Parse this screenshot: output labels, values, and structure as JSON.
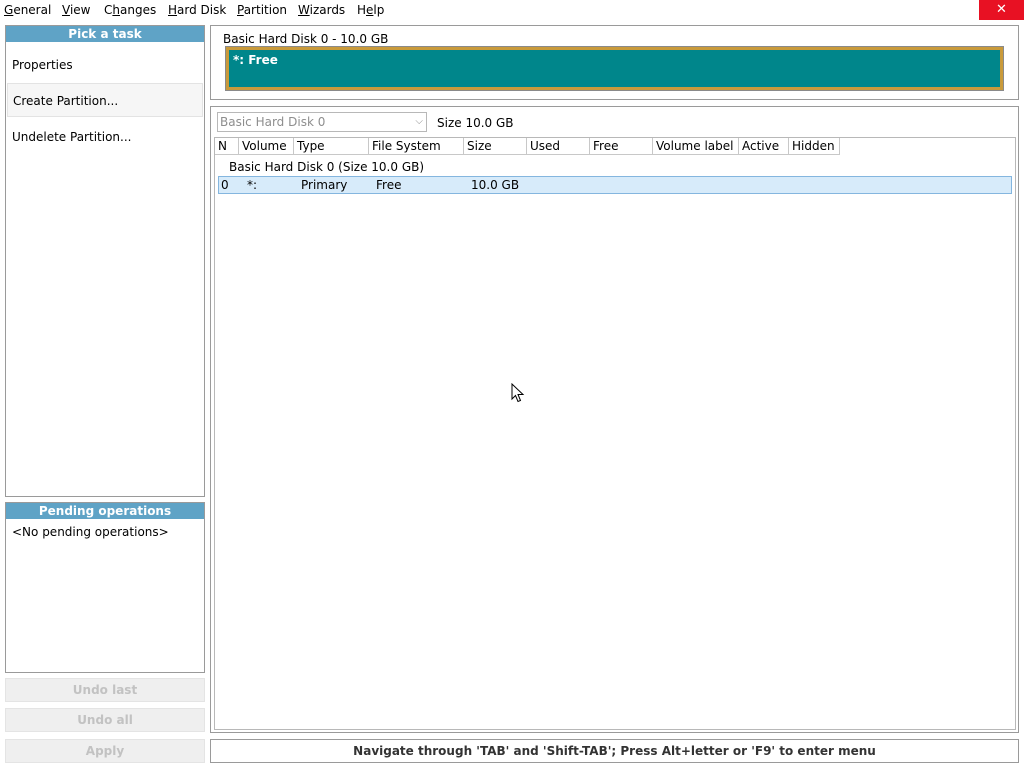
{
  "menu": {
    "items": [
      {
        "accel": "G",
        "rest": "eneral"
      },
      {
        "accel": "V",
        "rest": "iew"
      },
      {
        "pre": "C",
        "accel": "h",
        "rest": "anges"
      },
      {
        "accel": "H",
        "rest": "ard Disk"
      },
      {
        "accel": "P",
        "rest": "artition"
      },
      {
        "accel": "W",
        "rest": "izards"
      },
      {
        "pre": "H",
        "accel": "e",
        "rest": "lp"
      }
    ],
    "close_icon": "✕"
  },
  "tasks": {
    "header": "Pick a task",
    "items": [
      "Properties",
      "Create Partition...",
      "Undelete Partition..."
    ]
  },
  "pending": {
    "header": "Pending operations",
    "text": "<No pending operations>"
  },
  "buttons": {
    "undo_last": "Undo last",
    "undo_all": "Undo all",
    "apply": "Apply"
  },
  "disk_map": {
    "title": "Basic Hard Disk 0 - 10.0 GB",
    "bar_label": "*: Free",
    "colors": {
      "bar": "#00868b",
      "border": "#c99a3b"
    }
  },
  "disk_selector": {
    "value": "Basic Hard Disk 0",
    "size_label": "Size 10.0 GB"
  },
  "table": {
    "columns": [
      "N",
      "Volume",
      "Type",
      "File System",
      "Size",
      "Used",
      "Free",
      "Volume label",
      "Active",
      "Hidden"
    ],
    "group_label": "Basic Hard Disk 0 (Size 10.0 GB)",
    "rows": [
      {
        "n": "0",
        "volume": "*:",
        "type": "Primary",
        "fs": "Free",
        "size": "10.0 GB",
        "used": "",
        "free": "",
        "label": "",
        "active": "",
        "hidden": ""
      }
    ]
  },
  "status": "Navigate through 'TAB' and 'Shift-TAB'; Press Alt+letter or 'F9' to enter menu"
}
